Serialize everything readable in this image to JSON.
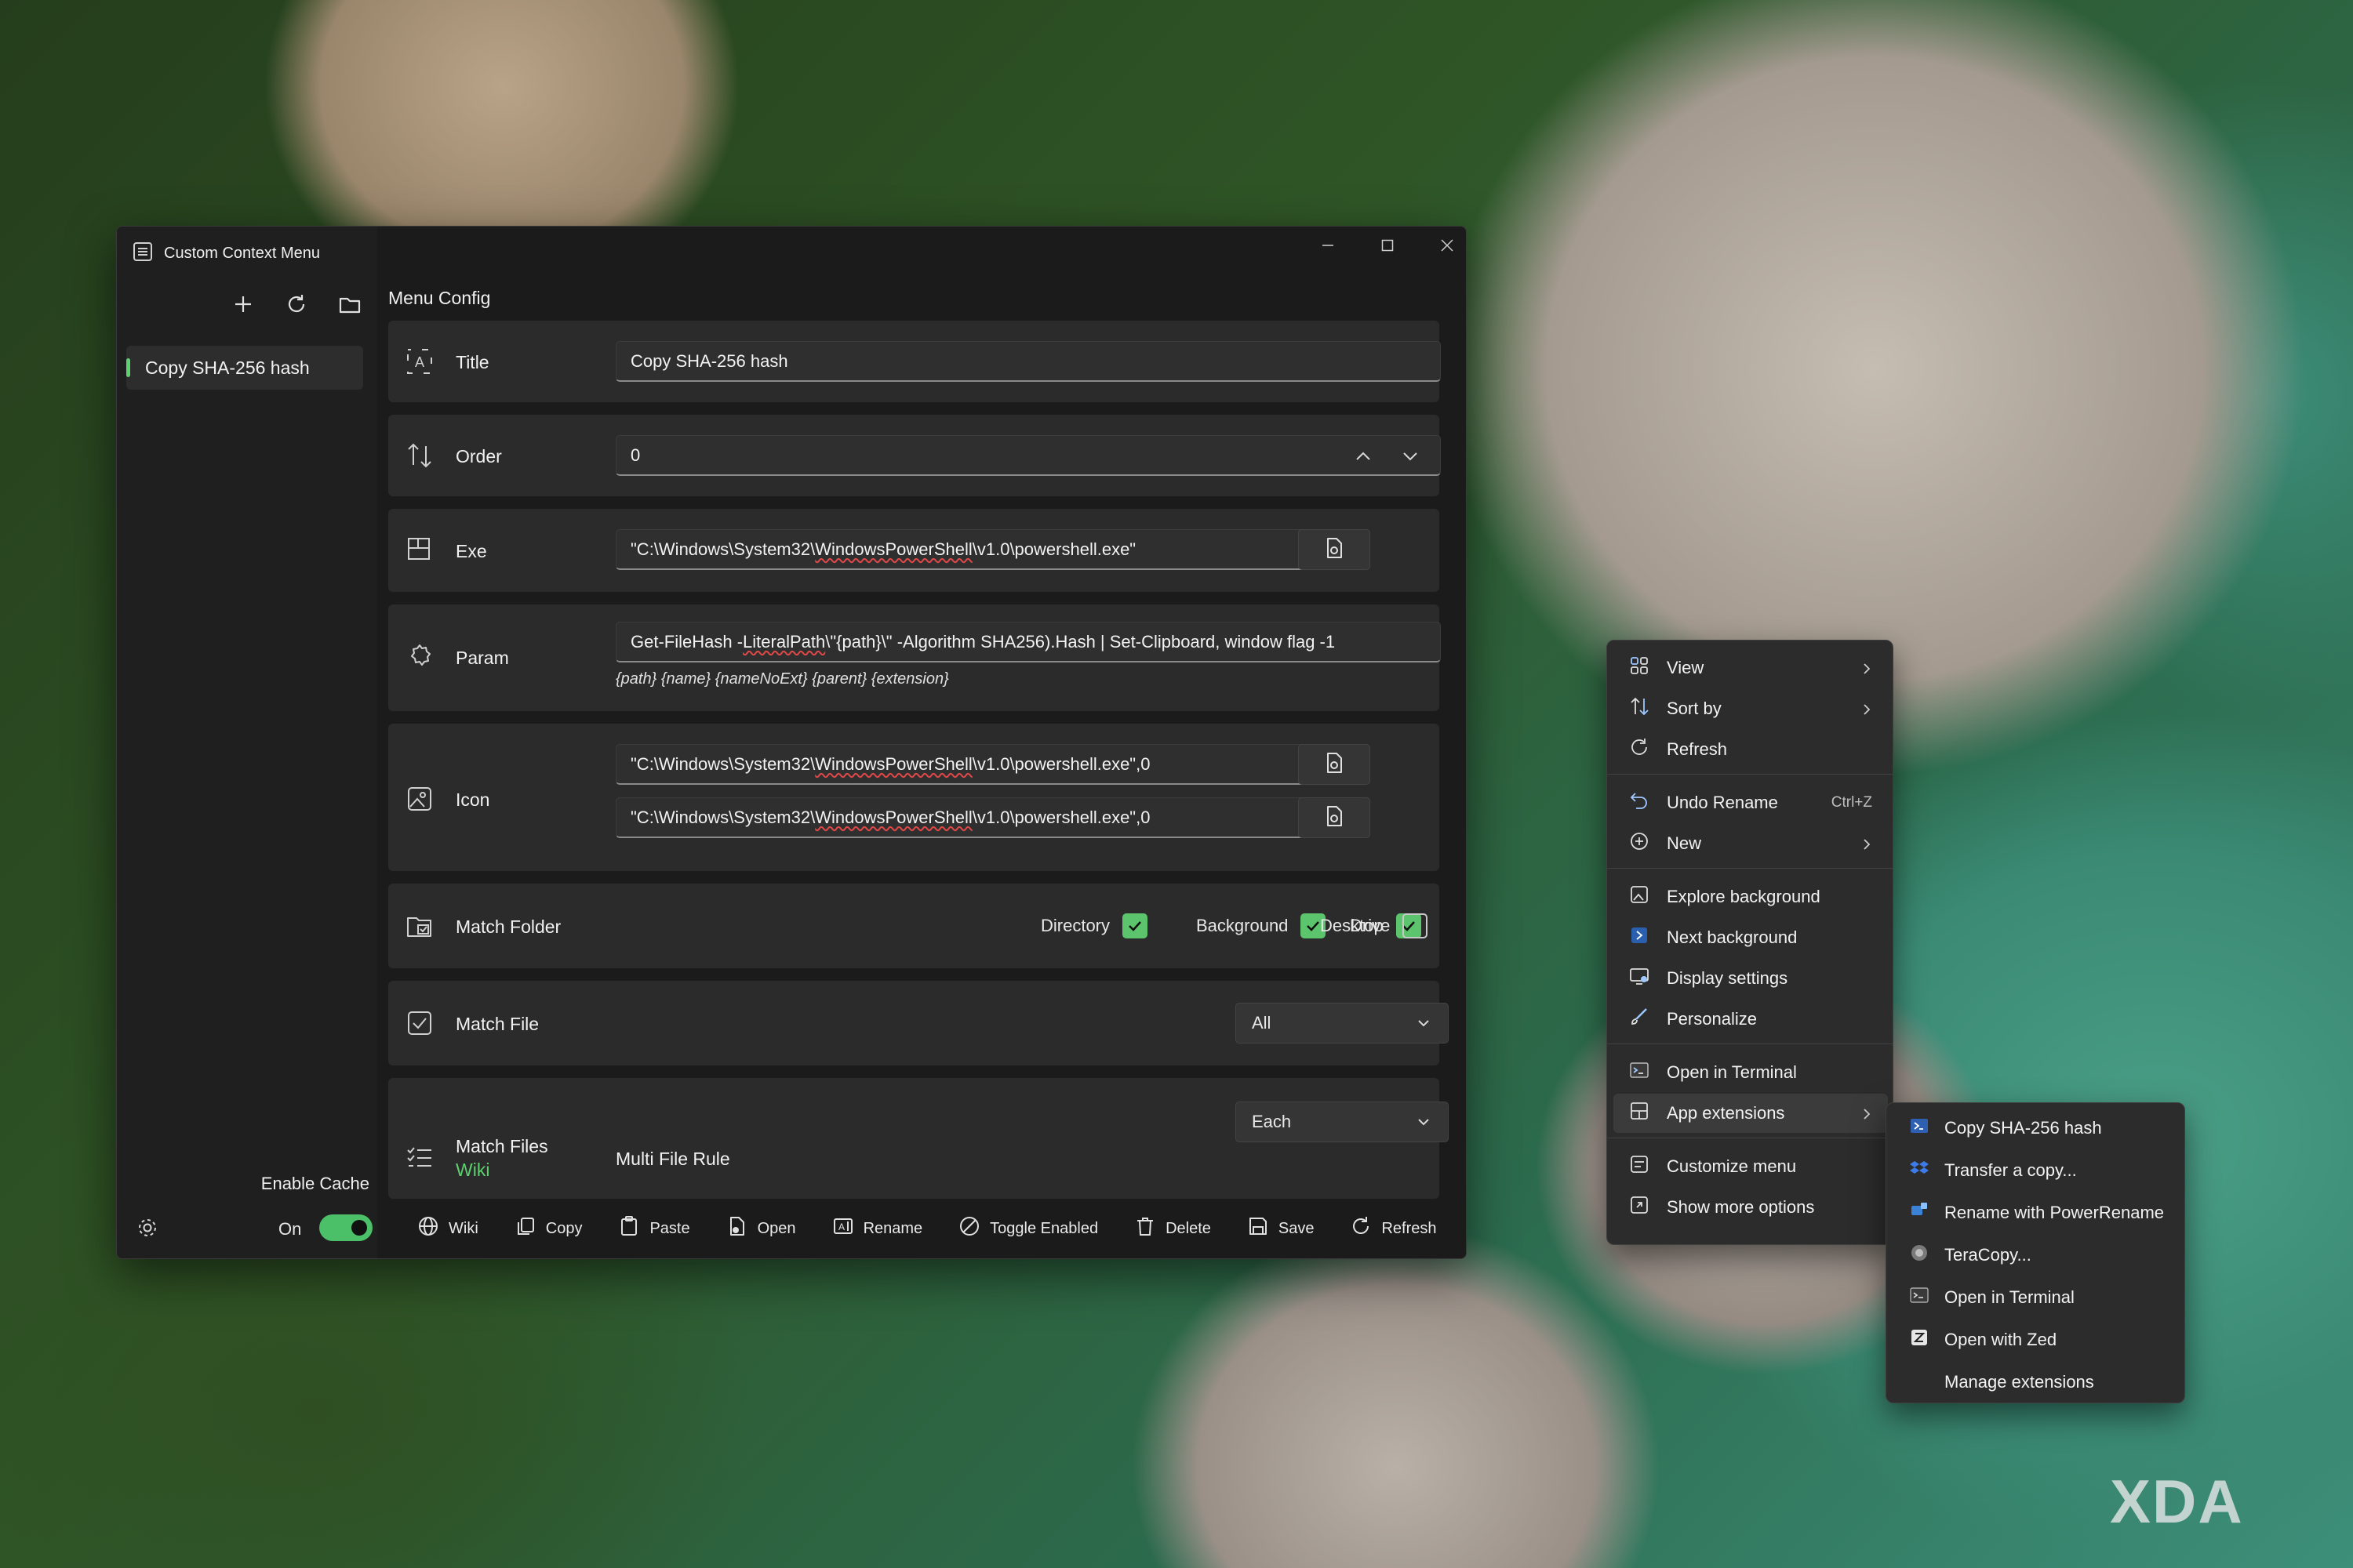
{
  "window": {
    "title": "Custom Context Menu"
  },
  "sidebar": {
    "items": [
      {
        "label": "Copy SHA-256 hash"
      }
    ],
    "enable_cache_label": "Enable Cache",
    "cache_state": "On"
  },
  "main": {
    "section_title": "Menu Config",
    "title": {
      "label": "Title",
      "value": "Copy SHA-256 hash"
    },
    "order": {
      "label": "Order",
      "value": "0"
    },
    "exe": {
      "label": "Exe",
      "prefix": "\"C:\\Windows\\System32\\",
      "word": "WindowsPowerShell",
      "suffix": "\\v1.0\\powershell.exe\""
    },
    "param": {
      "label": "Param",
      "value_prefix": "Get-FileHash -",
      "value_word": "LiteralPath",
      "value_suffix": " \\\"{path}\\\" -Algorithm SHA256).Hash | Set-Clipboard, window flag -1",
      "hint": "{path} {name} {nameNoExt} {parent} {extension}"
    },
    "icon": {
      "label": "Icon",
      "prefix": "\"C:\\Windows\\System32\\",
      "word": "WindowsPowerShell",
      "suffix": "\\v1.0\\powershell.exe\",0"
    },
    "match_folder": {
      "label": "Match Folder",
      "options": [
        {
          "label": "Directory",
          "checked": true
        },
        {
          "label": "Background",
          "checked": true
        },
        {
          "label": "Desktop",
          "checked": true
        },
        {
          "label": "Drive",
          "checked": false
        }
      ]
    },
    "match_file": {
      "label": "Match File",
      "selected": "All"
    },
    "match_files": {
      "label": "Match Files",
      "link": "Wiki",
      "rule_label": "Multi File Rule",
      "selected": "Each"
    }
  },
  "footer": {
    "buttons": [
      "Wiki",
      "Copy",
      "Paste",
      "Open",
      "Rename",
      "Toggle Enabled",
      "Delete",
      "Save",
      "Refresh"
    ]
  },
  "context_menu": {
    "items": [
      {
        "label": "View",
        "icon": "view-icon",
        "submenu": true
      },
      {
        "label": "Sort by",
        "icon": "sort-icon",
        "submenu": true
      },
      {
        "label": "Refresh",
        "icon": "refresh-icon"
      },
      {
        "label": "Undo Rename",
        "icon": "undo-icon",
        "shortcut": "Ctrl+Z"
      },
      {
        "label": "New",
        "icon": "new-icon",
        "submenu": true
      },
      {
        "label": "Explore background",
        "icon": "explore-icon"
      },
      {
        "label": "Next background",
        "icon": "next-background-icon"
      },
      {
        "label": "Display settings",
        "icon": "display-icon"
      },
      {
        "label": "Personalize",
        "icon": "brush-icon"
      },
      {
        "label": "Open in Terminal",
        "icon": "terminal-icon"
      },
      {
        "label": "App extensions",
        "icon": "extensions-icon",
        "submenu": true
      },
      {
        "label": "Customize menu",
        "icon": "customize-icon"
      },
      {
        "label": "Show more options",
        "icon": "more-options-icon"
      }
    ]
  },
  "submenu": {
    "items": [
      {
        "label": "Copy SHA-256 hash",
        "icon": "powershell-icon"
      },
      {
        "label": "Transfer a copy...",
        "icon": "dropbox-icon"
      },
      {
        "label": "Rename with PowerRename",
        "icon": "powerrename-icon"
      },
      {
        "label": "TeraCopy...",
        "icon": "teracopy-icon"
      },
      {
        "label": "Open in Terminal",
        "icon": "terminal-icon"
      },
      {
        "label": "Open with Zed",
        "icon": "zed-icon"
      },
      {
        "label": "Manage extensions",
        "icon": ""
      }
    ]
  },
  "watermark": "XDA",
  "colors": {
    "accent": "#5cc46c",
    "window_bg": "#202020",
    "card_bg": "#2b2b2b",
    "menu_bg": "#2c2c2c"
  }
}
